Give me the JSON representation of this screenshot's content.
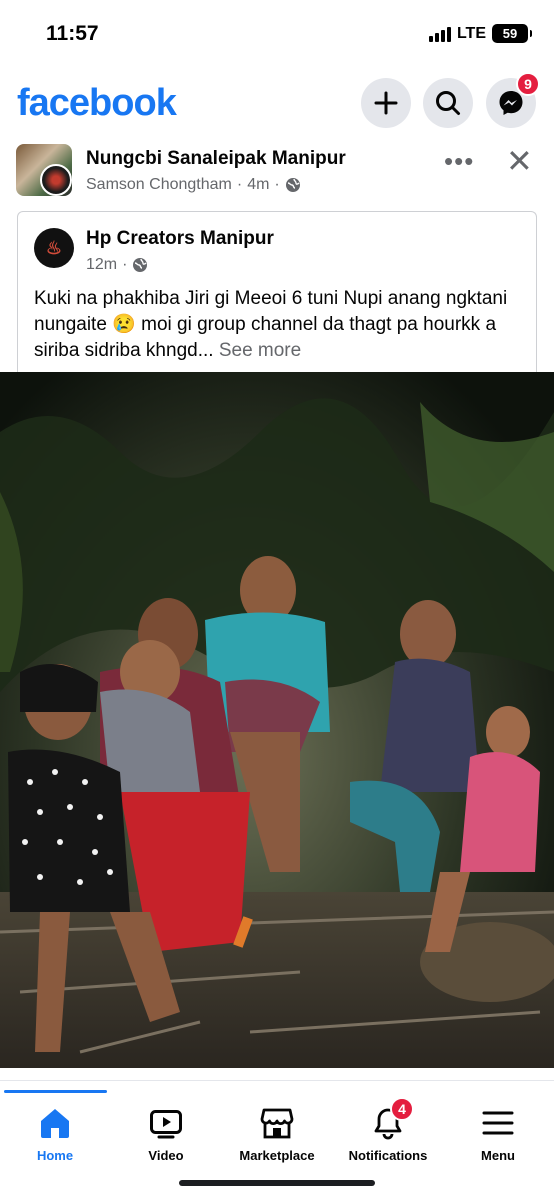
{
  "status_bar": {
    "time": "11:57",
    "network": "LTE",
    "battery": "59"
  },
  "header": {
    "logo": "facebook",
    "icons": [
      "plus-icon",
      "search-icon",
      "messenger-icon"
    ],
    "messenger_badge": "9",
    "brand_color": "#1877f2",
    "badge_color": "#e41e3f"
  },
  "post": {
    "group_name": "Nungcbi Sanaleipak Manipur",
    "author": "Samson Chongtham",
    "time": "4m",
    "shared": {
      "page_name": "Hp Creators Manipur",
      "time": "12m",
      "text": "Kuki na phakhiba Jiri gi Meeoi 6 tuni Nupi anang ngktani nungaite 😢 moi gi group channel da thagt pa hourkk a siriba sidriba khngd...",
      "see_more": "See more"
    }
  },
  "nav": {
    "items": [
      {
        "label": "Home",
        "icon": "home-icon",
        "active": true
      },
      {
        "label": "Video",
        "icon": "video-icon"
      },
      {
        "label": "Marketplace",
        "icon": "marketplace-icon"
      },
      {
        "label": "Notifications",
        "icon": "bell-icon",
        "badge": "4"
      },
      {
        "label": "Menu",
        "icon": "menu-icon"
      }
    ]
  }
}
